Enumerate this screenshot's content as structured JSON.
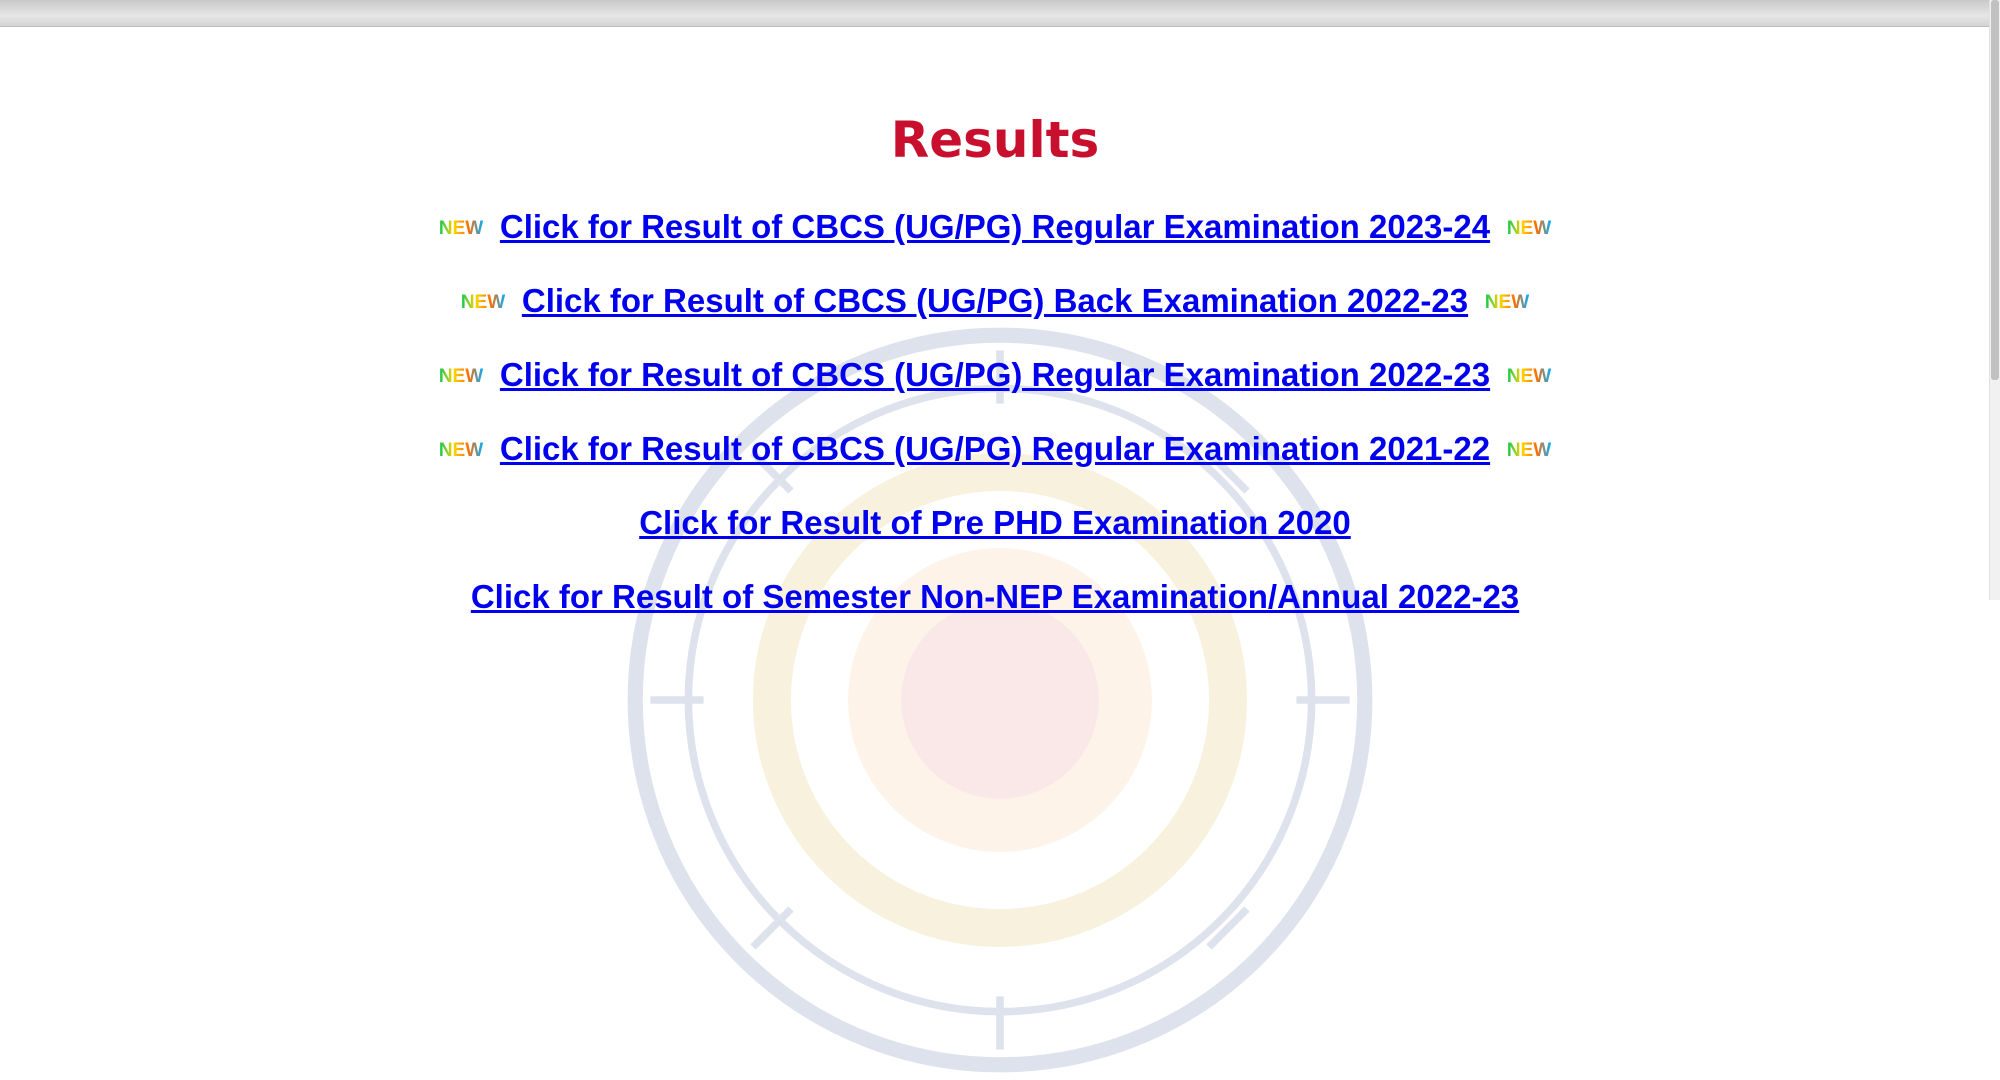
{
  "page": {
    "title": "Results"
  },
  "badge": {
    "text": "NEW",
    "colors": [
      "#00c853",
      "#ffd600",
      "#ff6d00",
      "#00b0ff"
    ]
  },
  "links": [
    {
      "label": "Click for Result of CBCS (UG/PG) Regular Examination 2023-24",
      "new": true
    },
    {
      "label": "Click for Result of CBCS (UG/PG) Back Examination 2022-23",
      "new": true
    },
    {
      "label": "Click for Result of CBCS (UG/PG) Regular Examination 2022-23",
      "new": true
    },
    {
      "label": "Click for Result of CBCS (UG/PG) Regular Examination 2021-22",
      "new": true
    },
    {
      "label": "Click for Result of Pre PHD Examination 2020",
      "new": false
    },
    {
      "label": "Click for Result of Semester Non-NEP Examination/Annual 2022-23",
      "new": false
    }
  ],
  "colors": {
    "title": "#c8102e",
    "link": "#0000ee"
  }
}
